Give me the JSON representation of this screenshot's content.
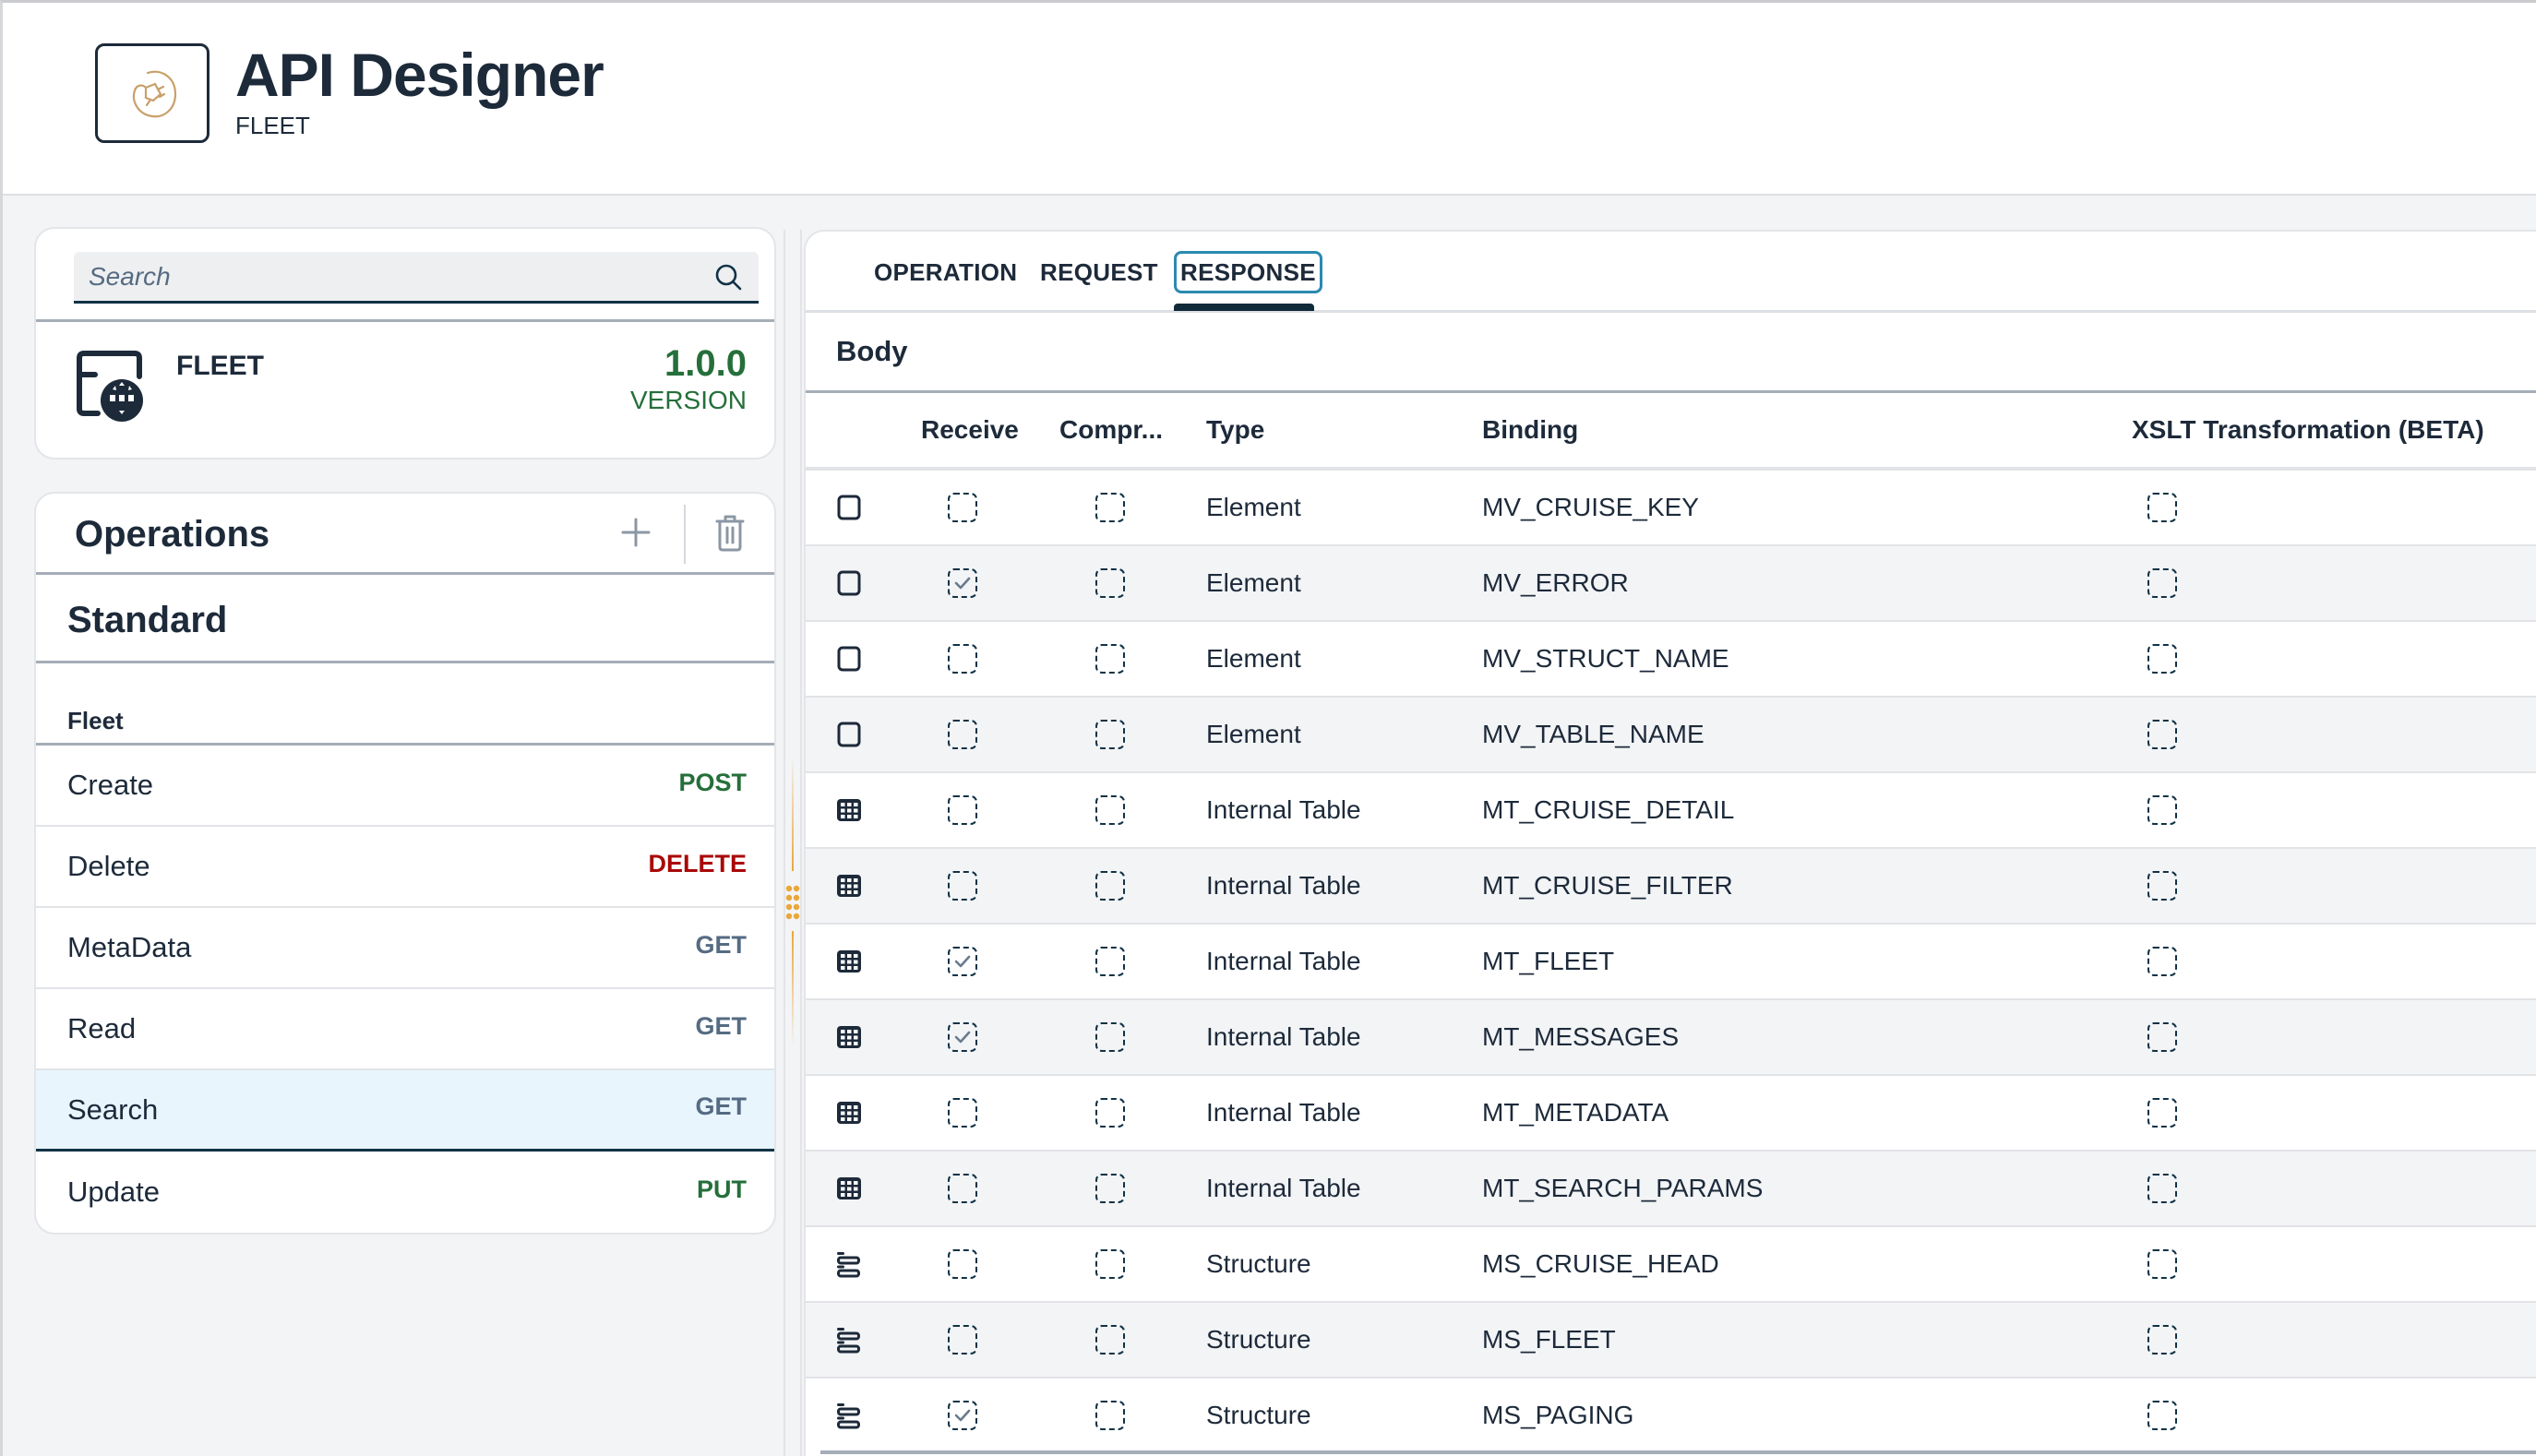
{
  "header": {
    "title": "API Designer",
    "subtitle": "FLEET",
    "logo_icon": "plug-connector-icon"
  },
  "api": {
    "search_placeholder": "Search",
    "search_value": "",
    "name": "FLEET",
    "version": "1.0.0",
    "version_label": "VERSION",
    "icon": "web-api-globe-icon"
  },
  "operations": {
    "title": "Operations",
    "add_icon": "plus-icon",
    "delete_icon": "trash-icon",
    "section": "Standard",
    "group": "Fleet",
    "items": [
      {
        "name": "Create",
        "method": "POST",
        "method_color": "#256f3a",
        "selected": false
      },
      {
        "name": "Delete",
        "method": "DELETE",
        "method_color": "#aa0808",
        "selected": false
      },
      {
        "name": "MetaData",
        "method": "GET",
        "method_color": "#556b82",
        "selected": false
      },
      {
        "name": "Read",
        "method": "GET",
        "method_color": "#556b82",
        "selected": false
      },
      {
        "name": "Search",
        "method": "GET",
        "method_color": "#556b82",
        "selected": true
      },
      {
        "name": "Update",
        "method": "PUT",
        "method_color": "#256f3a",
        "selected": false
      }
    ]
  },
  "tabs": [
    {
      "label": "OPERATION",
      "active": false
    },
    {
      "label": "REQUEST",
      "active": false
    },
    {
      "label": "RESPONSE",
      "active": true
    }
  ],
  "body": {
    "title": "Body",
    "columns": [
      "Receive",
      "Compr...",
      "Type",
      "Binding",
      "XSLT Transformation (BETA)"
    ],
    "rows": [
      {
        "icon": "element",
        "receive": false,
        "compress": false,
        "type": "Element",
        "binding": "MV_CRUISE_KEY",
        "xslt": false
      },
      {
        "icon": "element",
        "receive": true,
        "compress": false,
        "type": "Element",
        "binding": "MV_ERROR",
        "xslt": false
      },
      {
        "icon": "element",
        "receive": false,
        "compress": false,
        "type": "Element",
        "binding": "MV_STRUCT_NAME",
        "xslt": false
      },
      {
        "icon": "element",
        "receive": false,
        "compress": false,
        "type": "Element",
        "binding": "MV_TABLE_NAME",
        "xslt": false
      },
      {
        "icon": "table",
        "receive": false,
        "compress": false,
        "type": "Internal Table",
        "binding": "MT_CRUISE_DETAIL",
        "xslt": false
      },
      {
        "icon": "table",
        "receive": false,
        "compress": false,
        "type": "Internal Table",
        "binding": "MT_CRUISE_FILTER",
        "xslt": false
      },
      {
        "icon": "table",
        "receive": true,
        "compress": false,
        "type": "Internal Table",
        "binding": "MT_FLEET",
        "xslt": false
      },
      {
        "icon": "table",
        "receive": true,
        "compress": false,
        "type": "Internal Table",
        "binding": "MT_MESSAGES",
        "xslt": false
      },
      {
        "icon": "table",
        "receive": false,
        "compress": false,
        "type": "Internal Table",
        "binding": "MT_METADATA",
        "xslt": false
      },
      {
        "icon": "table",
        "receive": false,
        "compress": false,
        "type": "Internal Table",
        "binding": "MT_SEARCH_PARAMS",
        "xslt": false
      },
      {
        "icon": "structure",
        "receive": false,
        "compress": false,
        "type": "Structure",
        "binding": "MS_CRUISE_HEAD",
        "xslt": false
      },
      {
        "icon": "structure",
        "receive": false,
        "compress": false,
        "type": "Structure",
        "binding": "MS_FLEET",
        "xslt": false
      },
      {
        "icon": "structure",
        "receive": true,
        "compress": false,
        "type": "Structure",
        "binding": "MS_PAGING",
        "xslt": false
      }
    ]
  },
  "colors": {
    "accent_focus": "#2a8ab0",
    "text_primary": "#1d2a3a",
    "version_green": "#256f3a",
    "splitter_orange": "#e9a73c",
    "selected_row_bg": "#e8f5fd"
  }
}
